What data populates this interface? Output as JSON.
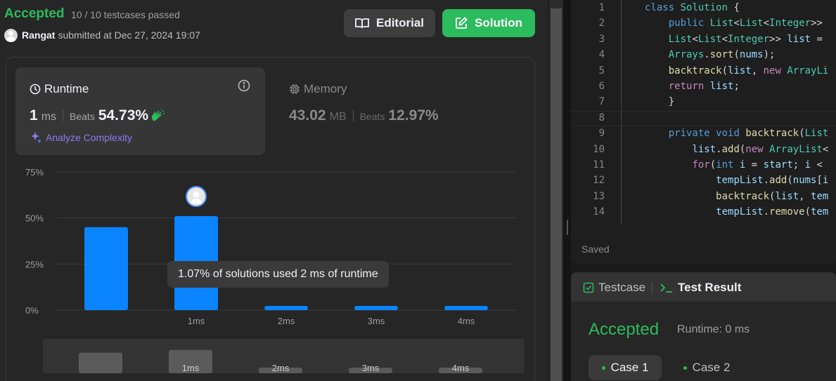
{
  "submission": {
    "status": "Accepted",
    "testcases": "10 / 10 testcases passed",
    "user": "Rangat",
    "submitted_text": "submitted at Dec 27, 2024 19:07"
  },
  "header": {
    "editorial_label": "Editorial",
    "solution_label": "Solution"
  },
  "runtime": {
    "title": "Runtime",
    "value": "1",
    "unit": "ms",
    "beats_label": "Beats",
    "beats_value": "54.73%",
    "analyze_label": "Analyze Complexity"
  },
  "memory": {
    "title": "Memory",
    "value": "43.02",
    "unit": "MB",
    "beats_label": "Beats",
    "beats_value": "12.97%"
  },
  "chart_data": {
    "type": "bar",
    "y_ticks": [
      "75%",
      "50%",
      "25%",
      "0%"
    ],
    "ylim": [
      0,
      75
    ],
    "categories": [
      "",
      "1ms",
      "2ms",
      "3ms",
      "4ms"
    ],
    "values": [
      45,
      51,
      1.07,
      1.07,
      1.07
    ],
    "highlight_index": 1,
    "tooltip": "1.07% of solutions used 2 ms of runtime",
    "overview_labels": [
      "",
      "1ms",
      "2ms",
      "3ms",
      "4ms"
    ],
    "colors": {
      "bar": "#0a84ff",
      "overview": "#5a5a5a",
      "grid": "#3c3c3c"
    }
  },
  "code": {
    "lines": [
      {
        "n": "1",
        "html": "<span class='kw'>class</span> <span class='ty'>Solution</span> {"
      },
      {
        "n": "2",
        "html": "    <span class='kw'>public</span> <span class='ty'>List</span>&lt;<span class='ty'>List</span>&lt;<span class='ty'>Integer</span>&gt;&gt;"
      },
      {
        "n": "3",
        "html": "    <span class='ty'>List</span>&lt;<span class='ty'>List</span>&lt;<span class='ty'>Integer</span>&gt;&gt; <span class='vr'>list</span> ="
      },
      {
        "n": "4",
        "html": "    <span class='ty'>Arrays</span>.<span class='fn'>sort</span>(<span class='vr'>nums</span>);"
      },
      {
        "n": "5",
        "html": "    <span class='fn'>backtrack</span>(<span class='vr'>list</span>, <span class='kw2'>new</span> <span class='ty'>ArrayLi</span>"
      },
      {
        "n": "6",
        "html": "    <span class='kw2'>return</span> <span class='vr'>list</span>;"
      },
      {
        "n": "7",
        "html": "    }"
      },
      {
        "n": "8",
        "html": ""
      },
      {
        "n": "9",
        "html": "    <span class='kw'>private</span> <span class='kw'>void</span> <span class='fn'>backtrack</span>(<span class='ty'>List</span>"
      },
      {
        "n": "10",
        "html": "        <span class='vr'>list</span>.<span class='fn'>add</span>(<span class='kw2'>new</span> <span class='ty'>ArrayList</span>&lt;"
      },
      {
        "n": "11",
        "html": "        <span class='kw2'>for</span>(<span class='kw'>int</span> <span class='vr'>i</span> = <span class='vr'>start</span>; <span class='vr'>i</span> &lt;"
      },
      {
        "n": "12",
        "html": "            <span class='vr'>tempList</span>.<span class='fn'>add</span>(<span class='vr'>nums</span>[<span class='vr'>i</span>"
      },
      {
        "n": "13",
        "html": "            <span class='fn'>backtrack</span>(<span class='vr'>list</span>, <span class='vr'>tem</span>"
      },
      {
        "n": "14",
        "html": "            <span class='vr'>tempList</span>.<span class='fn'>remove</span>(<span class='vr'>tem</span>"
      }
    ],
    "status": "Saved"
  },
  "test_panel": {
    "tab_testcase": "Testcase",
    "tab_result": "Test Result",
    "status": "Accepted",
    "runtime": "Runtime: 0 ms",
    "cases": [
      "Case 1",
      "Case 2"
    ]
  }
}
